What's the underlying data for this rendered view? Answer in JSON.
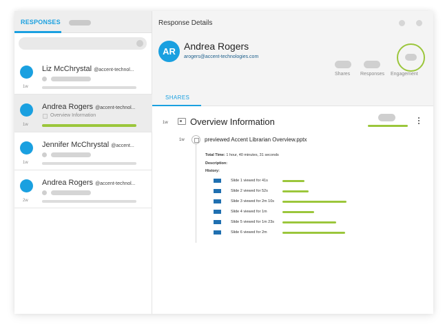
{
  "left_panel": {
    "tab_label": "RESPONSES",
    "items": [
      {
        "name": "Liz McChrystal",
        "handle": "@accent-technol...",
        "time": "1w",
        "sub_text": ""
      },
      {
        "name": "Andrea Rogers",
        "handle": "@accent-technol...",
        "time": "1w",
        "sub_text": "Overview Information"
      },
      {
        "name": "Jennifer McChrystal",
        "handle": "@accent...",
        "time": "1w",
        "sub_text": ""
      },
      {
        "name": "Andrea Rogers",
        "handle": "@accent-technol...",
        "time": "2w",
        "sub_text": ""
      }
    ]
  },
  "right_panel": {
    "title": "Response Details",
    "person": {
      "initials": "AR",
      "name": "Andrea Rogers",
      "email": "arogers@accent-technologies.com"
    },
    "stats": {
      "shares_label": "Shares",
      "responses_label": "Responses",
      "engagement_label": "Engagement"
    },
    "tab_label": "SHARES",
    "overview": {
      "time": "1w",
      "title": "Overview Information"
    },
    "event": {
      "time": "1w",
      "title": "previewed Accent Librarian Overview.pptx",
      "total_time_label": "Total Time:",
      "total_time_value": "1 hour, 40 minutes, 31 seconds",
      "description_label": "Description:",
      "history_label": "History:"
    },
    "slides": [
      {
        "label": "Slide 1",
        "viewed": "viewed for",
        "duration": "41s",
        "fraction": 0.33
      },
      {
        "label": "Slide 2",
        "viewed": "viewed for",
        "duration": "52s",
        "fraction": 0.4
      },
      {
        "label": "Slide 3",
        "viewed": "viewed for",
        "duration": "2m 10s",
        "fraction": 0.97
      },
      {
        "label": "Slide 4",
        "viewed": "viewed for",
        "duration": "1m",
        "fraction": 0.48
      },
      {
        "label": "Slide 5",
        "viewed": "viewed for",
        "duration": "1m 23s",
        "fraction": 0.81
      },
      {
        "label": "Slide 6",
        "viewed": "viewed for",
        "duration": "2m",
        "fraction": 0.95
      }
    ]
  },
  "colors": {
    "accent": "#1aa0e0",
    "green": "#9bc63b",
    "slide_icon": "#1f6fb0"
  }
}
